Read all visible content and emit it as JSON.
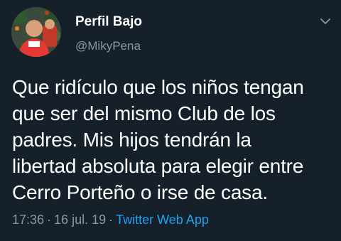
{
  "user": {
    "display_name": "Perfil Bajo",
    "handle": "@MikyPena",
    "avatar_icon": "profile-photo"
  },
  "menu": {
    "icon": "chevron-down-icon"
  },
  "tweet": {
    "lines": [
      "Que ridículo que los niños tengan",
      "que ser del mismo Club de los",
      "padres. Mis hijos tendrán la",
      "libertad absoluta para elegir entre",
      "Cerro Porteño o irse de casa."
    ]
  },
  "meta": {
    "time": "17:36",
    "separator": "·",
    "date": "16 jul. 19",
    "source": "Twitter Web App"
  },
  "colors": {
    "background": "#15202b",
    "secondary_text": "#8899a6",
    "link": "#1da1f2"
  }
}
